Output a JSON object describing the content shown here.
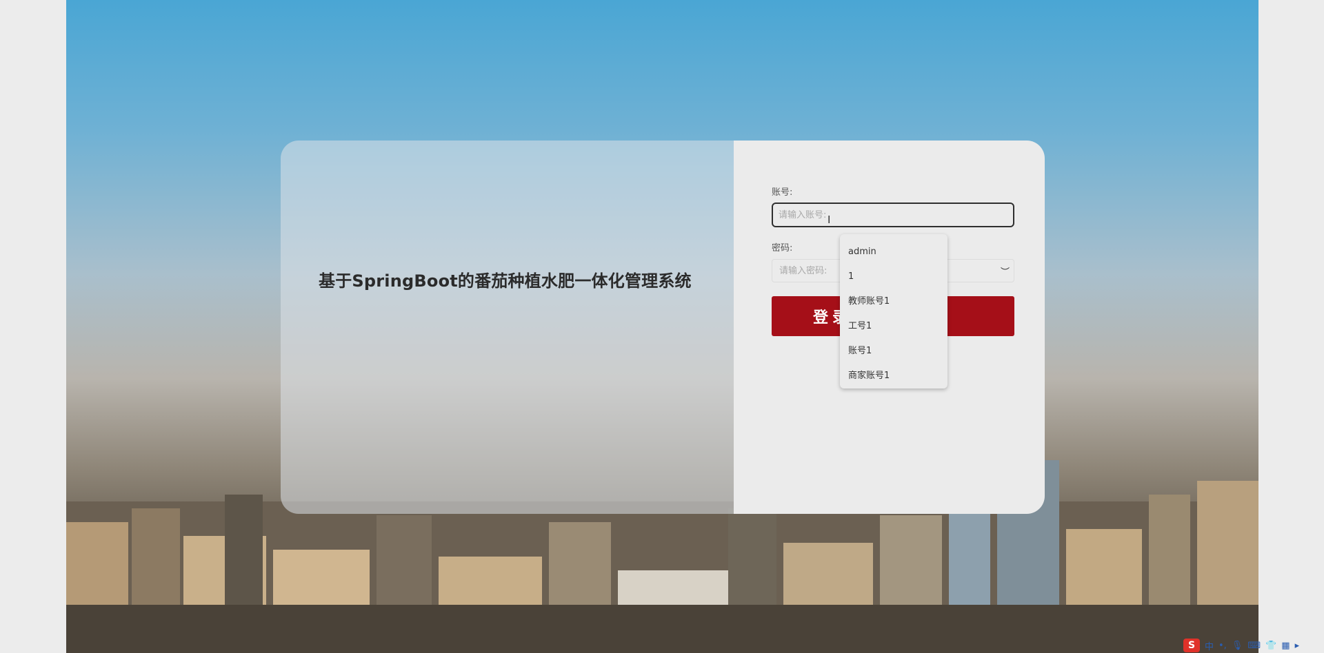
{
  "system_title": "基于SpringBoot的番茄种植水肥一体化管理系统",
  "login_form": {
    "account_label": "账号:",
    "account_placeholder": "请输入账号:",
    "password_label": "密码:",
    "password_placeholder": "请输入密码:",
    "login_button_label": "登录"
  },
  "autocomplete_options": [
    "admin",
    "1",
    "教师账号1",
    "工号1",
    "账号1",
    "商家账号1"
  ],
  "tray": {
    "ime_logo": "S",
    "ime_mode": "中",
    "icons": [
      "punctuation-icon",
      "microphone-icon",
      "keyboard-icon",
      "skin-icon",
      "toolbox-icon",
      "more-icon"
    ]
  },
  "colors": {
    "login_button": "#a50f18",
    "card_right": "#ebebeb"
  }
}
